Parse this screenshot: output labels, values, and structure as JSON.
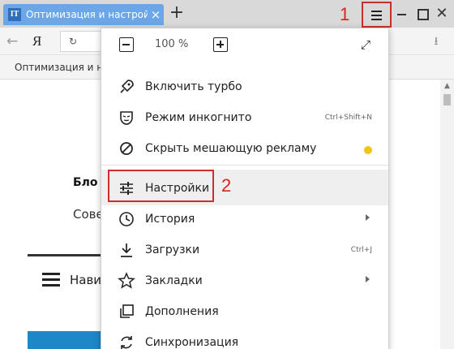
{
  "window": {
    "tab_title": "Оптимизация и настройка",
    "tab_favicon": "IT",
    "close_glyph": "×",
    "new_tab_glyph": "+",
    "step1": "1",
    "step2": "2",
    "window_close_glyph": "✕"
  },
  "toolbar": {
    "back_glyph": "←",
    "logo": "Я",
    "reload_glyph": "↻",
    "downloads_glyph": "⭳"
  },
  "bookmarks": {
    "item": "Оптимизация и на"
  },
  "page": {
    "blog_heading": "Бло",
    "subtitle": "Сове",
    "nav_label": "Нави"
  },
  "menu": {
    "zoom": "100 %",
    "fullscreen_glyph": "⤢",
    "items": [
      {
        "label": "Включить турбо",
        "icon": "rocket-icon"
      },
      {
        "label": "Режим инкогнито",
        "shortcut": "Ctrl+Shift+N",
        "icon": "incognito-mask-icon"
      },
      {
        "label": "Скрыть мешающую рекламу",
        "icon": "block-icon",
        "indicator_color": "#f0c419"
      },
      {
        "label": "Настройки",
        "icon": "settings-sliders-icon"
      },
      {
        "label": "История",
        "icon": "clock-icon"
      },
      {
        "label": "Загрузки",
        "shortcut": "Ctrl+J",
        "icon": "download-icon"
      },
      {
        "label": "Закладки",
        "icon": "star-icon"
      },
      {
        "label": "Дополнения",
        "icon": "addons-icon"
      },
      {
        "label": "Синхронизация",
        "icon": "sync-icon"
      }
    ]
  },
  "colors": {
    "annotation_red": "#c9302c",
    "tab_blue": "#6aa6e8",
    "page_banner": "#1d87c7"
  }
}
